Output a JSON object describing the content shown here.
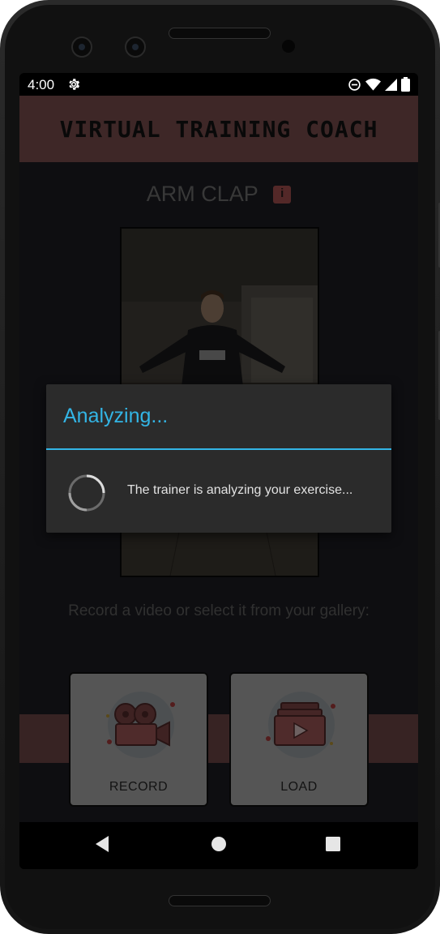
{
  "status_bar": {
    "time": "4:00",
    "icons": [
      "gear-icon",
      "do-not-disturb-icon",
      "wifi-icon",
      "signal-icon",
      "battery-icon"
    ]
  },
  "app": {
    "title": "VIRTUAL TRAINING COACH",
    "exercise_title": "ARM CLAP",
    "prompt": "Record a video or select it from your gallery:",
    "actions": {
      "record_label": "RECORD",
      "load_label": "LOAD"
    },
    "colors": {
      "header": "#8a5858",
      "background": "#202126",
      "accent": "#33b5e5"
    }
  },
  "dialog": {
    "title": "Analyzing...",
    "message": "The trainer is analyzing your exercise..."
  },
  "navigation_bar": {
    "buttons": [
      "back-icon",
      "home-icon",
      "recents-icon"
    ]
  }
}
